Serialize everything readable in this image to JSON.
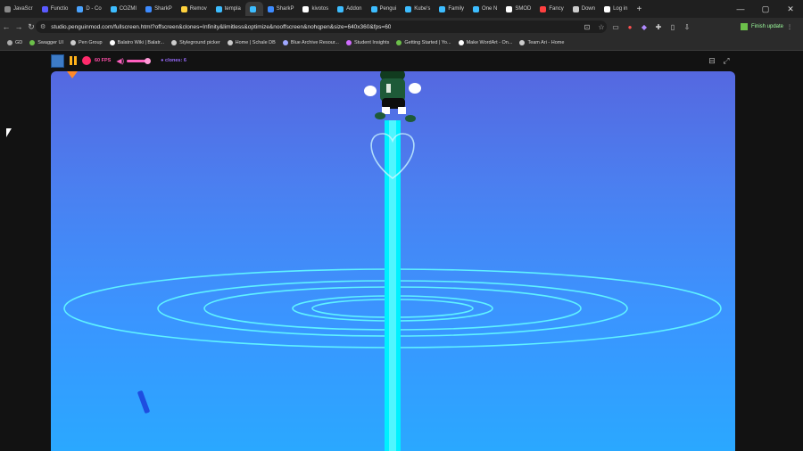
{
  "browser": {
    "tabs": [
      {
        "label": "JavaScr",
        "color": "#888"
      },
      {
        "label": "Functio",
        "color": "#5a5aff"
      },
      {
        "label": "D - Co",
        "color": "#4aa3ff"
      },
      {
        "label": "COZMI",
        "color": "#3dbdff"
      },
      {
        "label": "SharkP",
        "color": "#3d8bff"
      },
      {
        "label": "Remov",
        "color": "#ffd23d"
      },
      {
        "label": "templa",
        "color": "#3dbdff"
      },
      {
        "label": "",
        "color": "#3dbdff",
        "active": true
      },
      {
        "label": "SharkP",
        "color": "#3d8bff"
      },
      {
        "label": "kivotos",
        "color": "#fff"
      },
      {
        "label": "Addon",
        "color": "#3dbdff"
      },
      {
        "label": "Pengui",
        "color": "#3dbdff"
      },
      {
        "label": "Kube's",
        "color": "#3dbdff"
      },
      {
        "label": "Family",
        "color": "#3dbdff"
      },
      {
        "label": "One N",
        "color": "#3dbdff"
      },
      {
        "label": "SMOD",
        "color": "#fff"
      },
      {
        "label": "Fancy",
        "color": "#ff4040"
      },
      {
        "label": "Down",
        "color": "#ccc"
      },
      {
        "label": "Log in",
        "color": "#fff"
      }
    ],
    "url": "studio.penguinmod.com/fullscreen.html?offscreen&clones=Infinity&limitless&optimize&nooffscreen&nohqpen&size=640x360&fps=60",
    "finish_update": "Finish update",
    "bookmarks": [
      {
        "label": "GD",
        "color": "#aaa"
      },
      {
        "label": "Swagger UI",
        "color": "#6cc04a"
      },
      {
        "label": "Pen Group",
        "color": "#ccc"
      },
      {
        "label": "Balatro Wiki | Balatr...",
        "color": "#fff"
      },
      {
        "label": "Styleground picker",
        "color": "#ccc"
      },
      {
        "label": "Home | Schale DB",
        "color": "#ccc"
      },
      {
        "label": "Blue Archive Resour...",
        "color": "#9fa8ff"
      },
      {
        "label": "Student Insights",
        "color": "#d06cff"
      },
      {
        "label": "Getting Started | Yo...",
        "color": "#6cc04a"
      },
      {
        "label": "Make WordArt - On...",
        "color": "#fff"
      },
      {
        "label": "Team Ari - Home",
        "color": "#ccc"
      }
    ]
  },
  "player": {
    "fps_label": "60 FPS",
    "clones_label": "clones: 6",
    "colors": {
      "fps": "#ff4fa8",
      "clones": "#9a6bff",
      "beam": "#00f0ff",
      "ring": "#5ff2ff"
    }
  }
}
